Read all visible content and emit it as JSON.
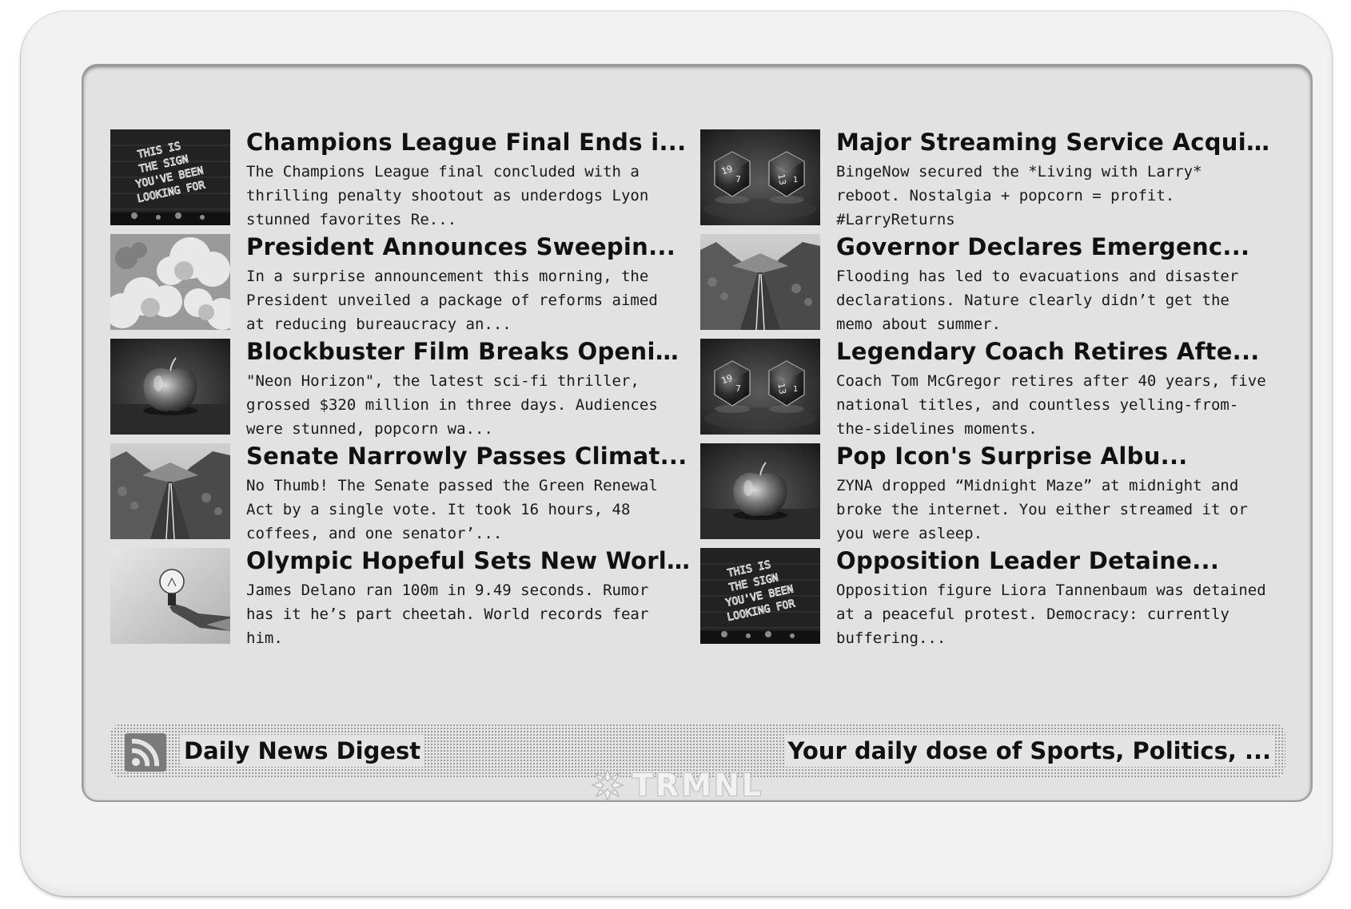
{
  "articles": [
    {
      "title": "Champions League Final Ends i...",
      "desc": "The Champions League final concluded with a thrilling penalty shootout as underdogs Lyon stunned favorites Re...",
      "image": "neon-sign"
    },
    {
      "title": "Major Streaming Service Acquire...",
      "desc": "BingeNow secured the *Living with Larry* reboot. Nostalgia + popcorn = profit. #LarryReturns",
      "image": "dice"
    },
    {
      "title": "President Announces Sweepin...",
      "desc": "In a surprise announcement this morning, the President unveiled a package of reforms aimed at reducing bureaucracy an...",
      "image": "clouds"
    },
    {
      "title": "Governor Declares Emergenc...",
      "desc": "Flooding has led to evacuations and disaster declarations. Nature clearly didn’t get the memo about summer.",
      "image": "road"
    },
    {
      "title": "Blockbuster Film Breaks Openin...",
      "desc": "\"Neon Horizon\", the latest sci-fi thriller, grossed $320 million in three days. Audiences were stunned, popcorn wa...",
      "image": "apple"
    },
    {
      "title": "Legendary Coach Retires Afte...",
      "desc": "Coach Tom McGregor retires after 40 years, five national titles, and countless yelling-from-the-sidelines moments.",
      "image": "dice"
    },
    {
      "title": "Senate Narrowly Passes Climat...",
      "desc": "No Thumb! The Senate passed the Green Renewal Act by a single vote. It took 16 hours, 48 coffees, and one senator’...",
      "image": "road"
    },
    {
      "title": "Pop Icon's Surprise Albu...",
      "desc": "ZYNA dropped “Midnight Maze” at midnight and broke the internet. You either streamed it or you were asleep.",
      "image": "apple"
    },
    {
      "title": "Olympic Hopeful Sets New Worl...",
      "desc": "James Delano ran 100m in 9.49 seconds. Rumor has it he’s part cheetah. World records fear him.",
      "image": "lightbulb"
    },
    {
      "title": "Opposition Leader Detaine...",
      "desc": "Opposition figure Liora Tannenbaum was detained at a peaceful protest. Democracy: currently buffering...",
      "image": "neon-sign"
    }
  ],
  "title_bar": {
    "icon": "rss-icon",
    "title": "Daily News Digest",
    "instance": "Your daily dose of Sports, Politics, ..."
  },
  "neon_sign_lines": [
    "THIS IS",
    "THE SIGN",
    "YOU'VE BEEN",
    "LOOKING FOR"
  ],
  "brand": {
    "name": "TRMNL"
  }
}
